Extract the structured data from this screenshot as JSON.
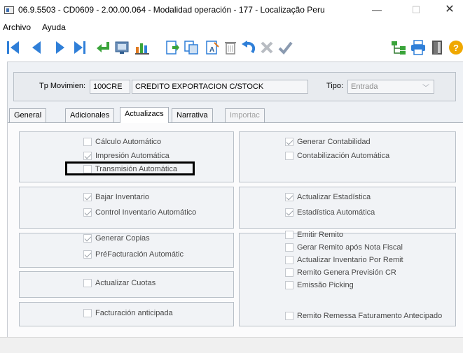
{
  "window": {
    "title": "06.9.5503 - CD0609 - 2.00.00.064 - Modalidad operación - 177 - Localização Peru",
    "minimize": "—",
    "maximize": "☐",
    "close": "✕"
  },
  "menu": [
    "Archivo",
    "Ayuda"
  ],
  "header": {
    "tp_label": "Tp Movimien:",
    "tp_code": "100CRE",
    "tp_desc": "CREDITO EXPORTACION C/STOCK",
    "tipo_label": "Tipo:",
    "tipo_value": "Entrada"
  },
  "tabs": [
    {
      "label": "General",
      "active": false,
      "disabled": false
    },
    {
      "label": "Adicionales",
      "active": false,
      "disabled": false
    },
    {
      "label": "Actualizacs",
      "active": true,
      "disabled": false
    },
    {
      "label": "Narrativa",
      "active": false,
      "disabled": false
    },
    {
      "label": "Importac",
      "active": false,
      "disabled": true
    }
  ],
  "checkboxes": {
    "calculo_automatico": {
      "label": "Cálculo Automático",
      "checked": false
    },
    "impresion_automatica": {
      "label": "Impresión Automática",
      "checked": true
    },
    "transmision_automatica": {
      "label": "Transmisión Automática",
      "checked": false
    },
    "generar_contabilidad": {
      "label": "Generar Contabilidad",
      "checked": true
    },
    "contabilizacion_automatica": {
      "label": "Contabilización Automática",
      "checked": false
    },
    "bajar_inventario": {
      "label": "Bajar Inventario",
      "checked": true
    },
    "control_inventario": {
      "label": "Control Inventario Automático",
      "checked": true
    },
    "actualizar_estadistica": {
      "label": "Actualizar Estadística",
      "checked": true
    },
    "estadistica_automatica": {
      "label": "Estadística Automática",
      "checked": true
    },
    "generar_copias": {
      "label": "Generar Copias",
      "checked": true
    },
    "prefacturacion": {
      "label": "PréFacturación Automátic",
      "checked": true
    },
    "actualizar_cuotas": {
      "label": "Actualizar Cuotas",
      "checked": false
    },
    "facturacion_anticipada": {
      "label": "Facturación anticipada",
      "checked": false
    },
    "emitir_remito": {
      "label": "Emitir Remito",
      "checked": false
    },
    "gerar_remito": {
      "label": "Gerar Remito após Nota Fiscal",
      "checked": false
    },
    "actualizar_inventario_remit": {
      "label": "Actualizar Inventario Por Remit",
      "checked": false
    },
    "remito_prevision": {
      "label": "Remito Genera Previsión CR",
      "checked": false
    },
    "emissao_picking": {
      "label": "Emissão Picking",
      "checked": false
    },
    "remito_remessa": {
      "label": "Remito Remessa Faturamento Antecipado",
      "checked": false
    }
  },
  "icons": [
    "first-record-icon",
    "previous-record-icon",
    "next-record-icon",
    "last-record-icon",
    "return-icon",
    "screen-icon",
    "chart-icon",
    "new-record-icon",
    "copy-icon",
    "edit-icon",
    "delete-icon",
    "undo-icon",
    "cancel-icon",
    "confirm-icon",
    "tree-icon",
    "print-icon",
    "exit-icon",
    "help-icon"
  ],
  "colors": {
    "accent": "#2f7fd8",
    "return_arrow": "#3aa43a",
    "print": "#2f7fd8",
    "help": "#f0a800"
  }
}
